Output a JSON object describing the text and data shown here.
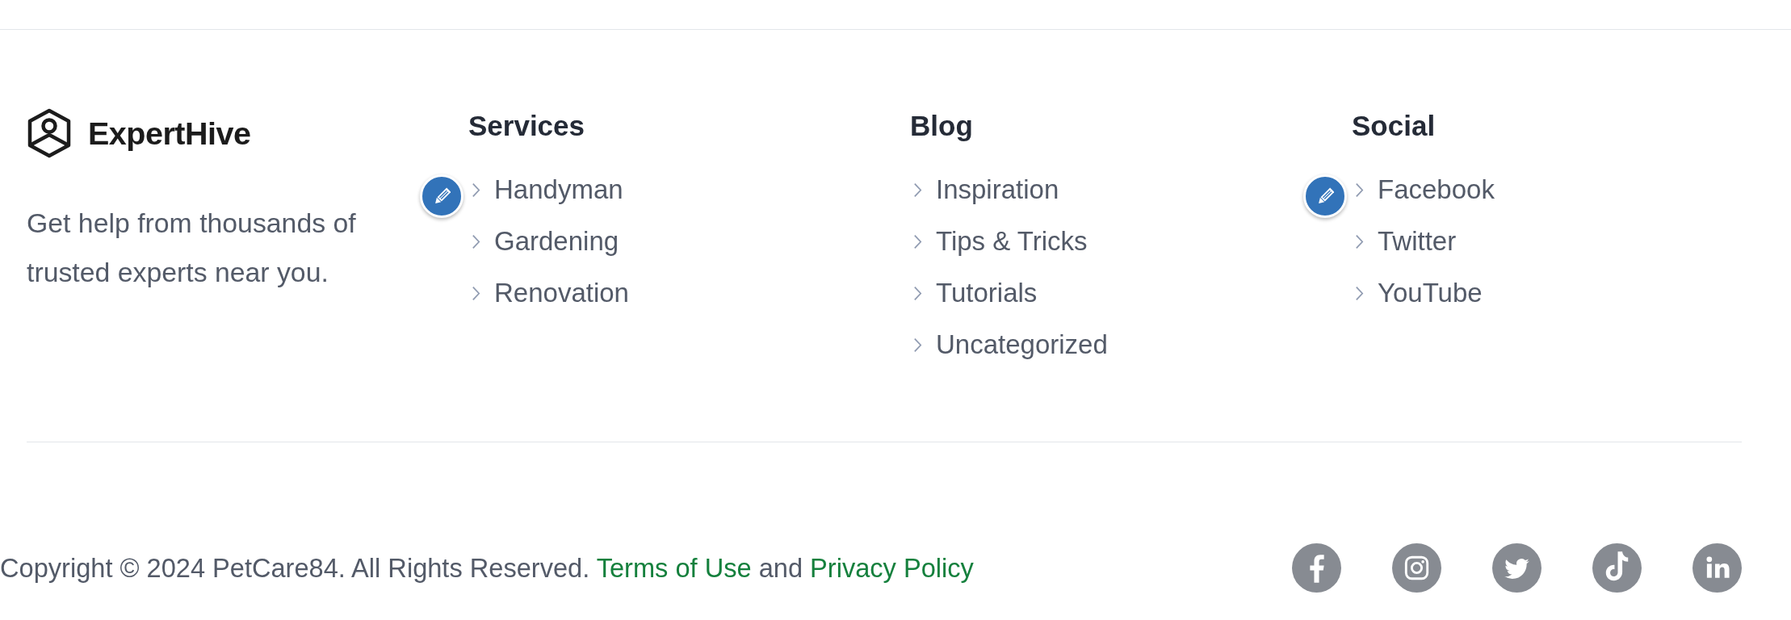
{
  "brand": {
    "name": "ExpertHive",
    "tagline": "Get help from thousands of trusted experts near you."
  },
  "columns": [
    {
      "heading": "Services",
      "edit_shortcut": true,
      "links": [
        "Handyman",
        "Gardening",
        "Renovation"
      ]
    },
    {
      "heading": "Blog",
      "edit_shortcut": false,
      "links": [
        "Inspiration",
        "Tips & Tricks",
        "Tutorials",
        "Uncategorized"
      ]
    },
    {
      "heading": "Social",
      "edit_shortcut": true,
      "links": [
        "Facebook",
        "Twitter",
        "YouTube"
      ]
    }
  ],
  "copyright": {
    "parts": [
      {
        "kind": "text",
        "text": "Copyright © 2024 PetCare84. All Rights Reserved."
      },
      {
        "kind": "link",
        "text": "Terms of Use"
      },
      {
        "kind": "text",
        "text": "and"
      },
      {
        "kind": "link",
        "text": "Privacy Policy"
      }
    ]
  },
  "social_icons": [
    {
      "kind": "facebook"
    },
    {
      "kind": "instagram"
    },
    {
      "kind": "twitter"
    },
    {
      "kind": "tiktok"
    },
    {
      "kind": "linkedin"
    }
  ]
}
